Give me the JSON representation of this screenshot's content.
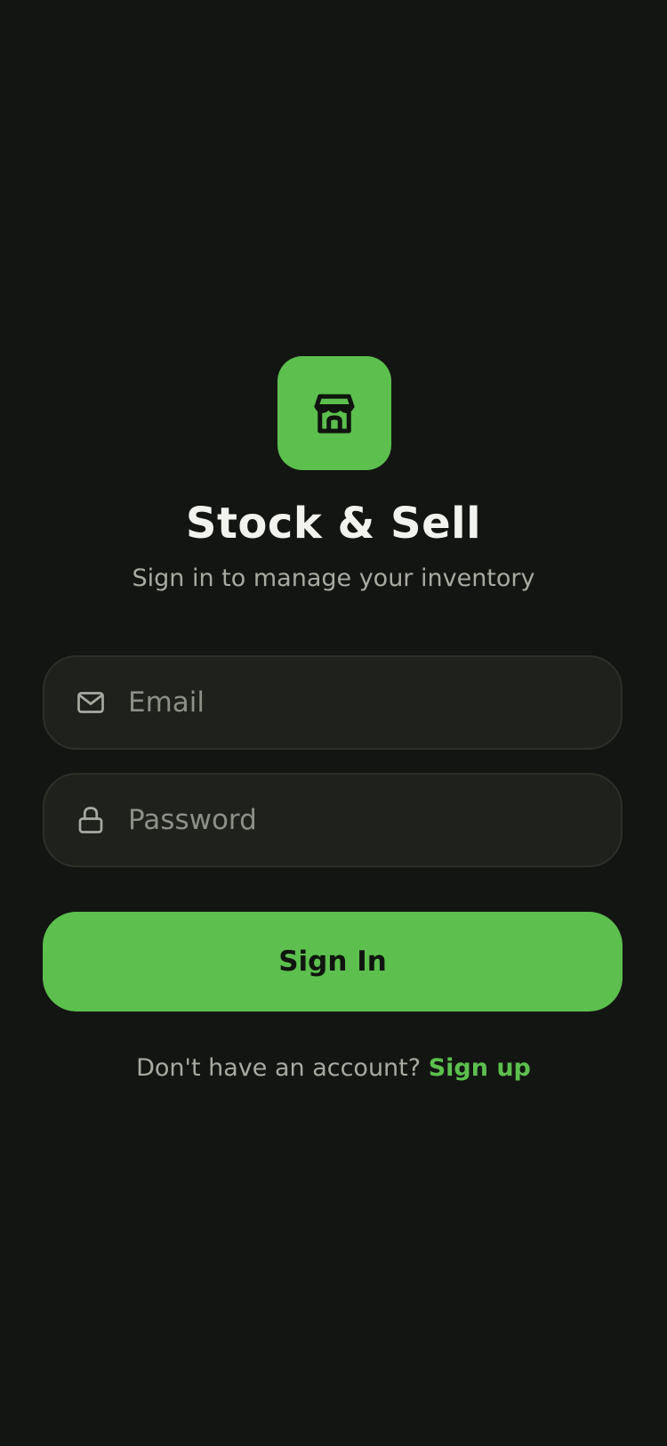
{
  "app": {
    "title": "Stock & Sell",
    "subtitle": "Sign in to manage your inventory",
    "icon": "storefront-icon"
  },
  "form": {
    "email": {
      "icon": "mail-icon",
      "placeholder": "Email",
      "value": ""
    },
    "password": {
      "icon": "lock-icon",
      "placeholder": "Password",
      "value": ""
    },
    "submit_label": "Sign In"
  },
  "footer": {
    "prompt": "Don't have an account?",
    "link_label": "Sign up"
  },
  "colors": {
    "background": "#131512",
    "accent": "#5cbf4e",
    "field_background": "#1e211c",
    "field_border": "#2c3029",
    "text_primary": "#f2f3ee",
    "text_secondary": "#a8aaa2"
  }
}
